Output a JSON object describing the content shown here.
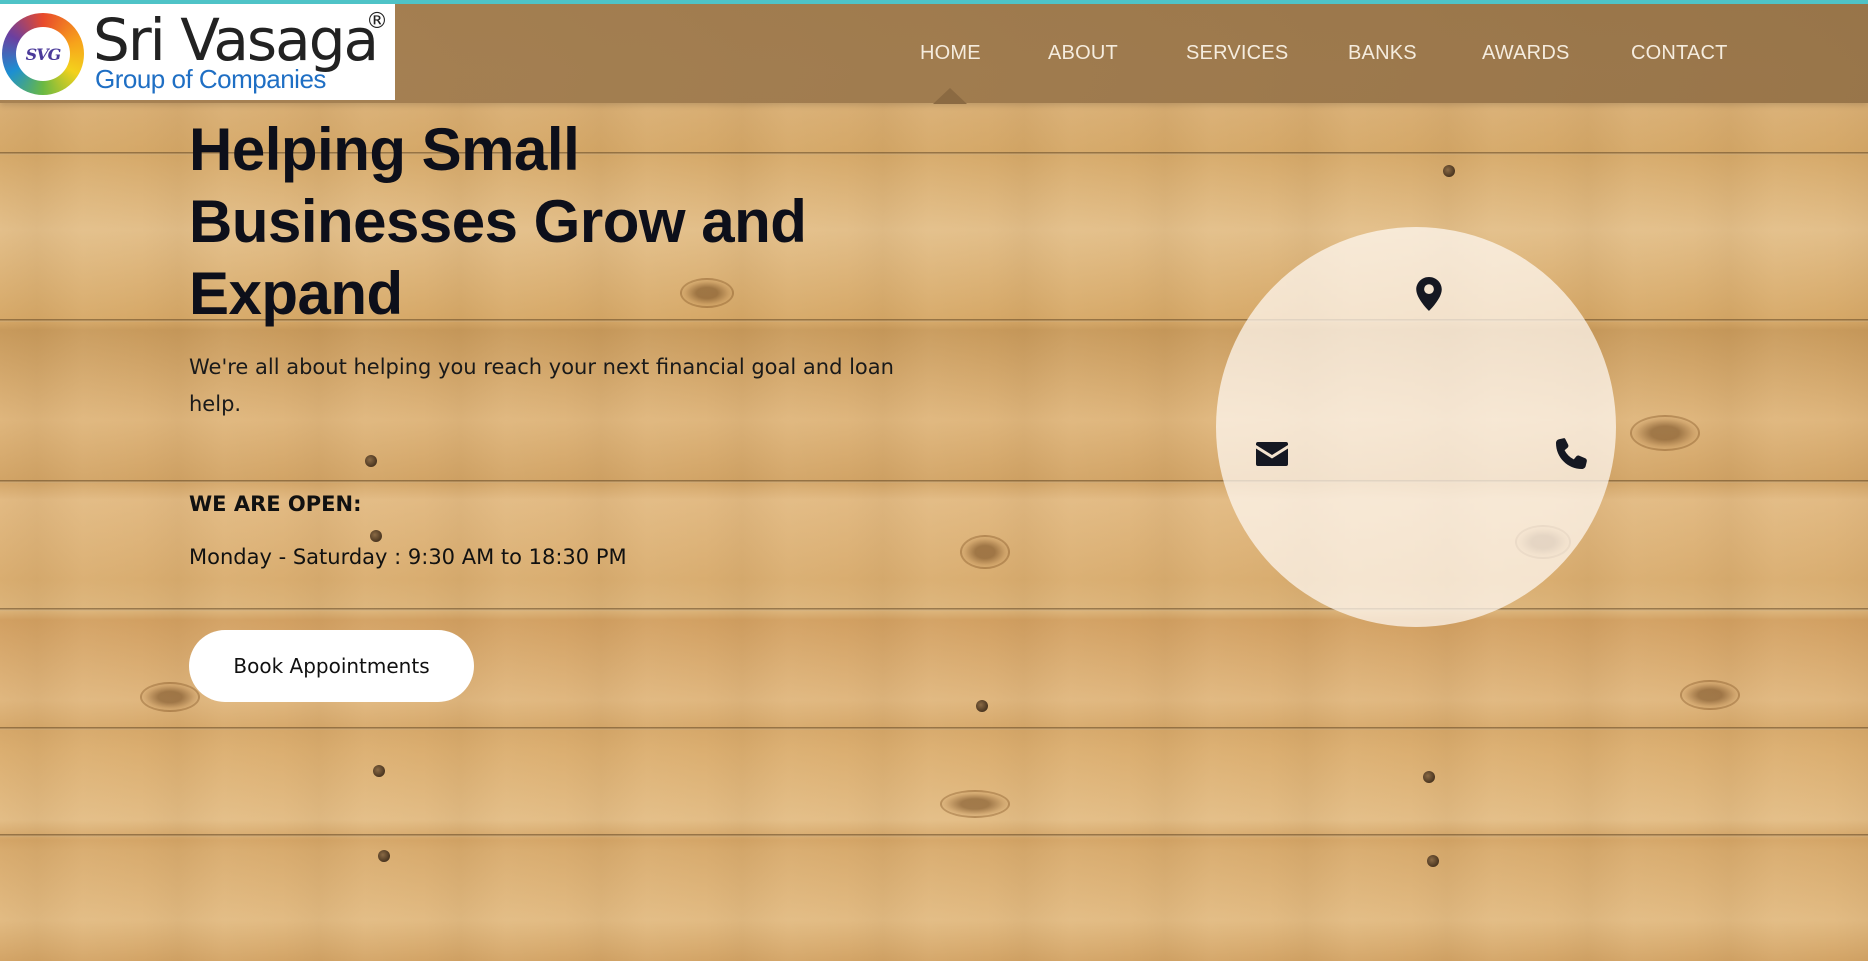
{
  "brand": {
    "logo_mark": "SVG",
    "name": "Sri Vasaga",
    "registered": "®",
    "tagline": "Group of Companies"
  },
  "nav": {
    "items": [
      {
        "label": "HOME",
        "active": true
      },
      {
        "label": "ABOUT",
        "active": false
      },
      {
        "label": "SERVICES",
        "active": false
      },
      {
        "label": "BANKS",
        "active": false
      },
      {
        "label": "AWARDS",
        "active": false
      },
      {
        "label": "CONTACT",
        "active": false
      }
    ]
  },
  "hero": {
    "title": "Helping Small Businesses Grow and Expand",
    "subtitle": "We're all about helping you reach your next financial goal and loan help.",
    "open_heading": "WE ARE OPEN:",
    "open_hours": "Monday - Saturday : 9:30 AM to 18:30 PM",
    "cta_label": "Book Appointments"
  },
  "contact_icons": [
    {
      "name": "map-pin-icon"
    },
    {
      "name": "envelope-icon"
    },
    {
      "name": "phone-icon"
    }
  ],
  "colors": {
    "accent": "#4fc3c7",
    "header": "#a5805",
    "title_text": "#0d0f1a",
    "nav_text": "#f5ecde"
  }
}
